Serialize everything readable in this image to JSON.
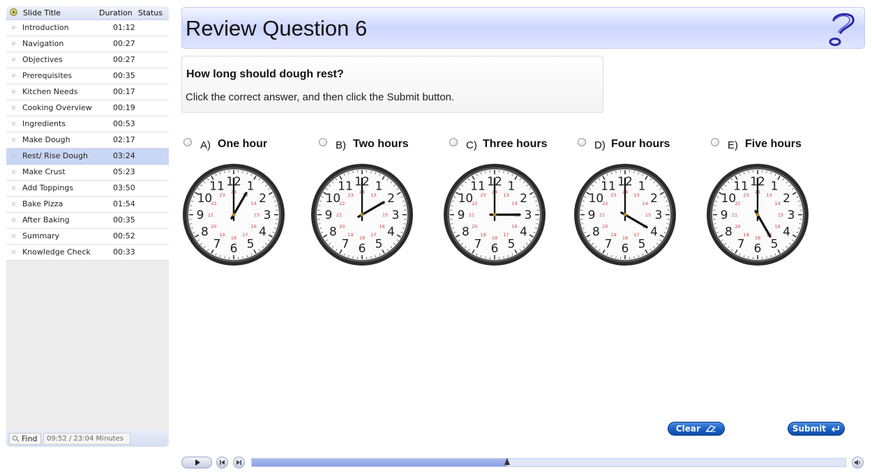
{
  "sidebar": {
    "header": {
      "title": "Slide Title",
      "duration": "Duration",
      "status": "Status"
    },
    "items": [
      {
        "title": "Introduction",
        "duration": "01:12"
      },
      {
        "title": "Navigation",
        "duration": "00:27"
      },
      {
        "title": "Objectives",
        "duration": "00:27"
      },
      {
        "title": "Prerequisites",
        "duration": "00:35"
      },
      {
        "title": "Kitchen Needs",
        "duration": "00:17"
      },
      {
        "title": "Cooking Overview",
        "duration": "00:19"
      },
      {
        "title": "Ingredients",
        "duration": "00:53"
      },
      {
        "title": "Make Dough",
        "duration": "02:17"
      },
      {
        "title": "Rest/ Rise Dough",
        "duration": "03:24"
      },
      {
        "title": "Make Crust",
        "duration": "05:23"
      },
      {
        "title": "Add Toppings",
        "duration": "03:50"
      },
      {
        "title": "Bake Pizza",
        "duration": "01:54"
      },
      {
        "title": "After Baking",
        "duration": "00:35"
      },
      {
        "title": "Summary",
        "duration": "00:52"
      },
      {
        "title": "Knowledge Check",
        "duration": "00:33"
      }
    ],
    "active_index": 8,
    "footer": {
      "find_label": "Find",
      "time_label": "09:52 / 23:04 Minutes"
    }
  },
  "slide": {
    "title": "Review Question 6",
    "help_icon": "question-mark-icon",
    "question": "How long should dough rest?",
    "instruction": "Click the correct answer, and  then click the Submit button.",
    "answers": [
      {
        "letter": "A)",
        "text": "One hour",
        "hour": 1
      },
      {
        "letter": "B)",
        "text": "Two hours",
        "hour": 2
      },
      {
        "letter": "C)",
        "text": "Three hours",
        "hour": 3
      },
      {
        "letter": "D)",
        "text": "Four hours",
        "hour": 4
      },
      {
        "letter": "E)",
        "text": "Five hours",
        "hour": 5
      }
    ],
    "clock_numbers": [
      "12",
      "1",
      "2",
      "3",
      "4",
      "5",
      "6",
      "7",
      "8",
      "9",
      "10",
      "11"
    ],
    "clock_inner_numbers": [
      "24",
      "13",
      "14",
      "15",
      "16",
      "17",
      "18",
      "19",
      "20",
      "21",
      "22",
      "23"
    ],
    "clear_label": "Clear",
    "submit_label": "Submit"
  },
  "player": {
    "progress": 0.43
  },
  "colors": {
    "accent": "#1a5fc2",
    "active_row": "#c9d6f5",
    "title_bar": "#cdd6ff",
    "clock_red": "#d63a3a"
  }
}
